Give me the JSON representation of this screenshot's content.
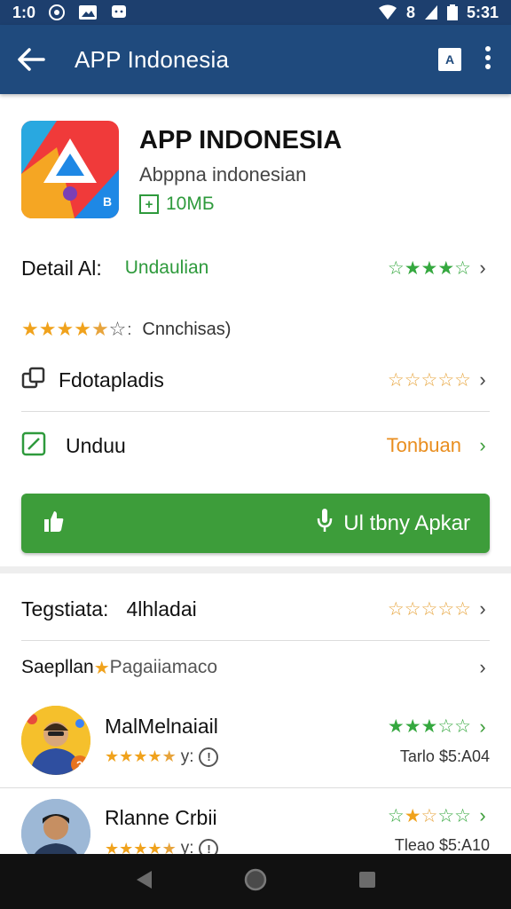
{
  "status_bar": {
    "time_left": "1:0",
    "time_right": "5:31",
    "signal_text": "8",
    "icons": [
      "chrome-icon",
      "photo-icon",
      "chat-icon",
      "wifi-icon",
      "signal-icon",
      "battery-icon"
    ]
  },
  "app_bar": {
    "title": "APP Indonesia",
    "translate_label": "A",
    "icons": [
      "back-arrow-icon",
      "translate-icon",
      "more-vert-icon"
    ]
  },
  "app": {
    "name": "APP INDONESIA",
    "subtitle": "Abppna indonesian",
    "size_badge": "+",
    "size": "10МБ"
  },
  "rows": {
    "detail_label": "Detail Al:",
    "detail_value": "Undaulian",
    "rating_text": "Cnnchisas)",
    "files_label": "Fdotapladis",
    "unduh_label": "Unduu",
    "unduh_value": "Tonbuan"
  },
  "install_button": {
    "right_label": "Ul tbny Apkar"
  },
  "reviews": {
    "header_label": "Tegstiata:",
    "header_value": "4lhladai",
    "sample_label": "Saepllan",
    "sample_value": "Pagaiiamaco",
    "items": [
      {
        "name": "MalMelnaiail",
        "stars_label": "y:",
        "price": "Tarlo $5:A04"
      },
      {
        "name": "Rlanne Crbii",
        "stars_label": "y:",
        "price": "Tleao $5:A10"
      }
    ]
  },
  "colors": {
    "app_bar": "#1f4a7d",
    "status_bar": "#1d3f6e",
    "green": "#3d9d3a",
    "orange": "#e98e1f",
    "nav": "#111111"
  }
}
